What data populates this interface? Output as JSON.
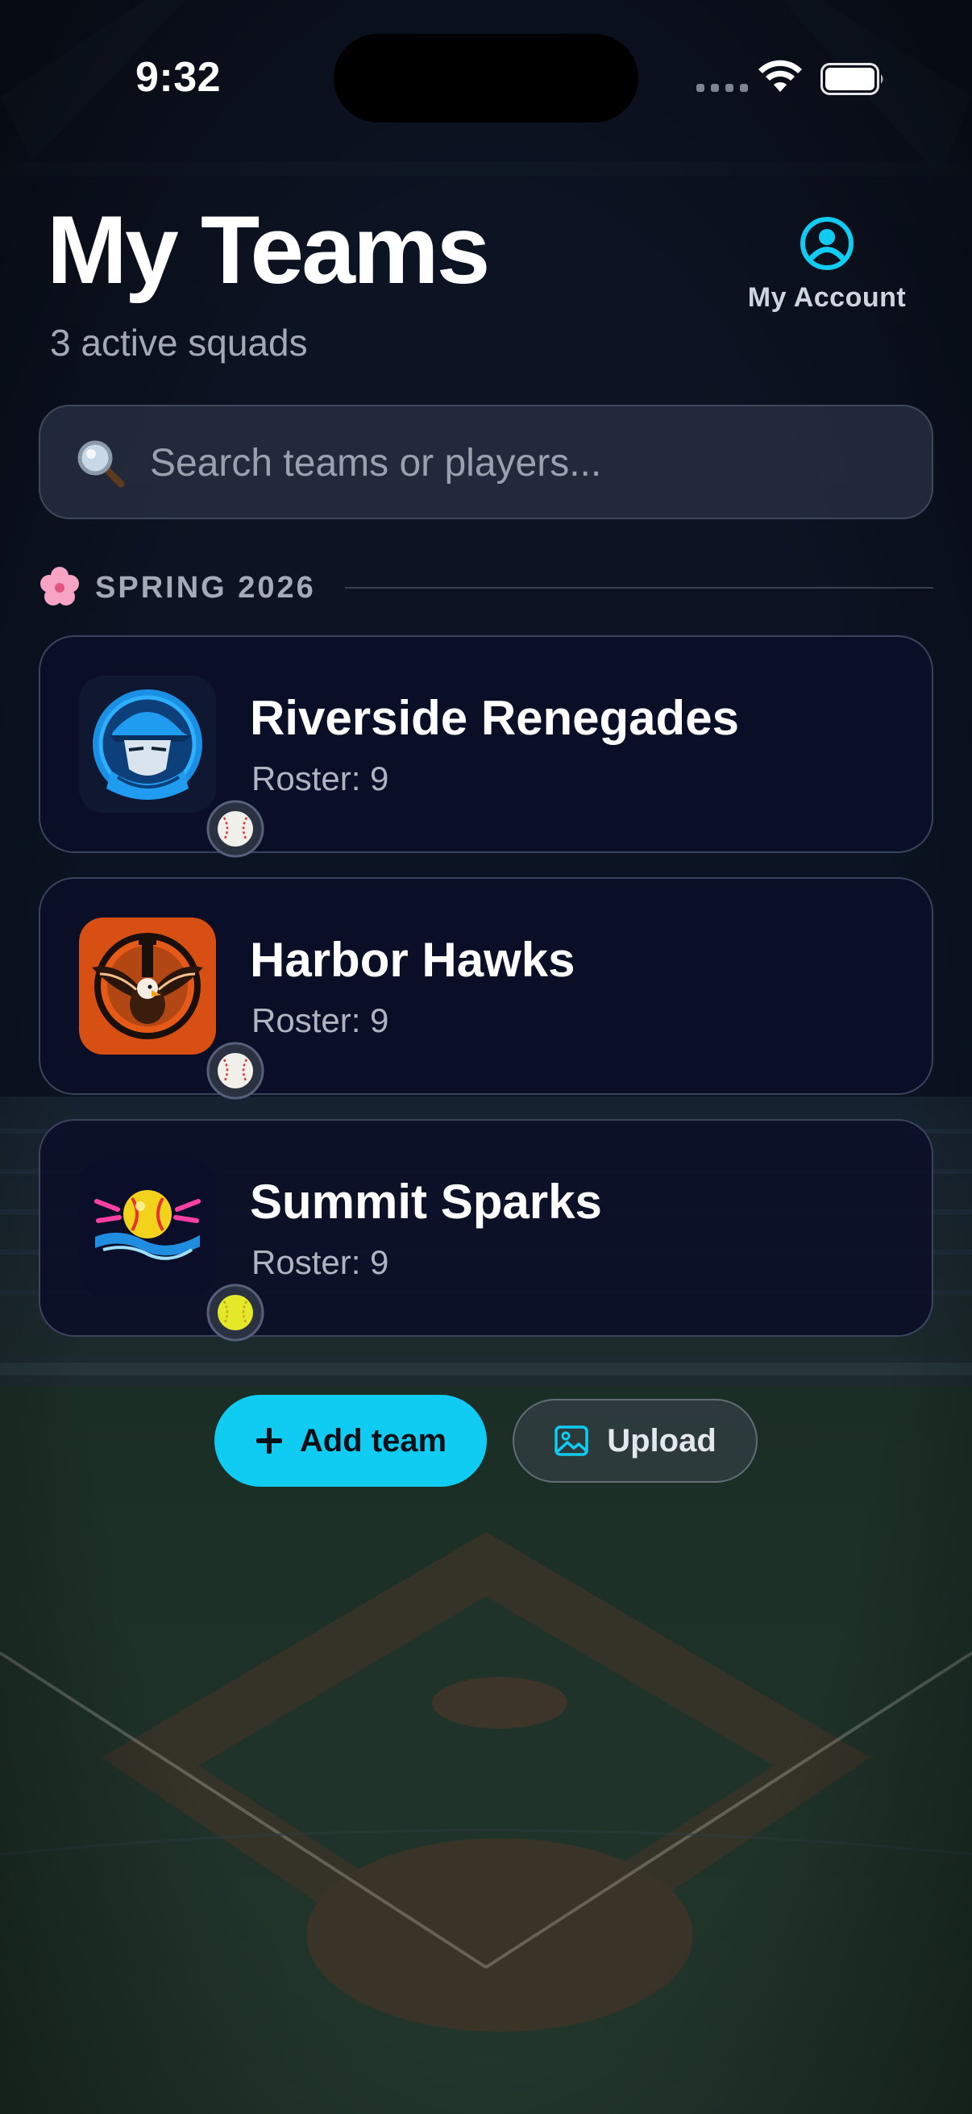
{
  "status_bar": {
    "time": "9:32"
  },
  "header": {
    "title": "My Teams",
    "subtitle": "3 active squads",
    "account_label": "My Account"
  },
  "search": {
    "placeholder": "Search teams or players..."
  },
  "section": {
    "emoji": "🌸",
    "title": "SPRING 2026"
  },
  "teams": [
    {
      "name": "Riverside Renegades",
      "roster": "Roster: 9",
      "logo": "renegades-logo",
      "sport_icon": "baseball-icon"
    },
    {
      "name": "Harbor Hawks",
      "roster": "Roster: 9",
      "logo": "hawks-logo",
      "sport_icon": "baseball-icon"
    },
    {
      "name": "Summit Sparks",
      "roster": "Roster: 9",
      "logo": "sparks-logo",
      "sport_icon": "softball-icon"
    }
  ],
  "actions": {
    "add_label": "Add team",
    "upload_label": "Upload"
  },
  "colors": {
    "accent": "#11ccf2",
    "card_bg": "#0a0e28",
    "text_secondary": "#aeb4c0"
  }
}
